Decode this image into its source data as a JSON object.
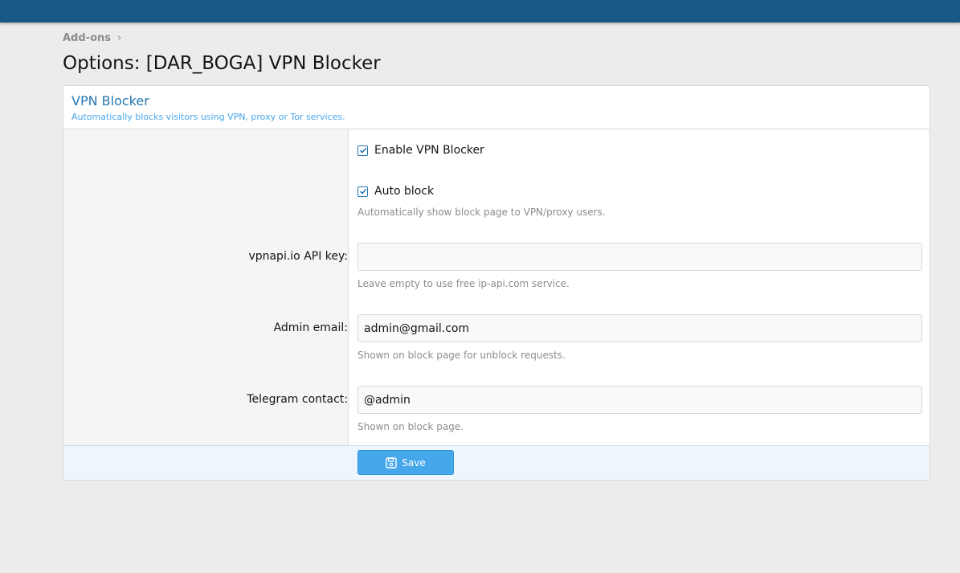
{
  "breadcrumb": {
    "items": [
      "Add-ons"
    ]
  },
  "page": {
    "title": "Options: [DAR_BOGA] VPN Blocker"
  },
  "block": {
    "title": "VPN Blocker",
    "description": "Automatically blocks visitors using VPN, proxy or Tor services."
  },
  "options": {
    "enable": {
      "label": "Enable VPN Blocker",
      "checked": true
    },
    "auto_block": {
      "label": "Auto block",
      "checked": true,
      "hint": "Automatically show block page to VPN/proxy users."
    },
    "api_key": {
      "label": "vpnapi.io API key:",
      "value": "",
      "hint": "Leave empty to use free ip-api.com service."
    },
    "admin_email": {
      "label": "Admin email:",
      "value": "admin@gmail.com",
      "hint": "Shown on block page for unblock requests."
    },
    "telegram": {
      "label": "Telegram contact:",
      "value": "@admin",
      "hint": "Shown on block page."
    }
  },
  "footer": {
    "save_label": "Save"
  },
  "colors": {
    "topbar": "#185886",
    "accent": "#2577b1",
    "button": "#47a7eb"
  }
}
